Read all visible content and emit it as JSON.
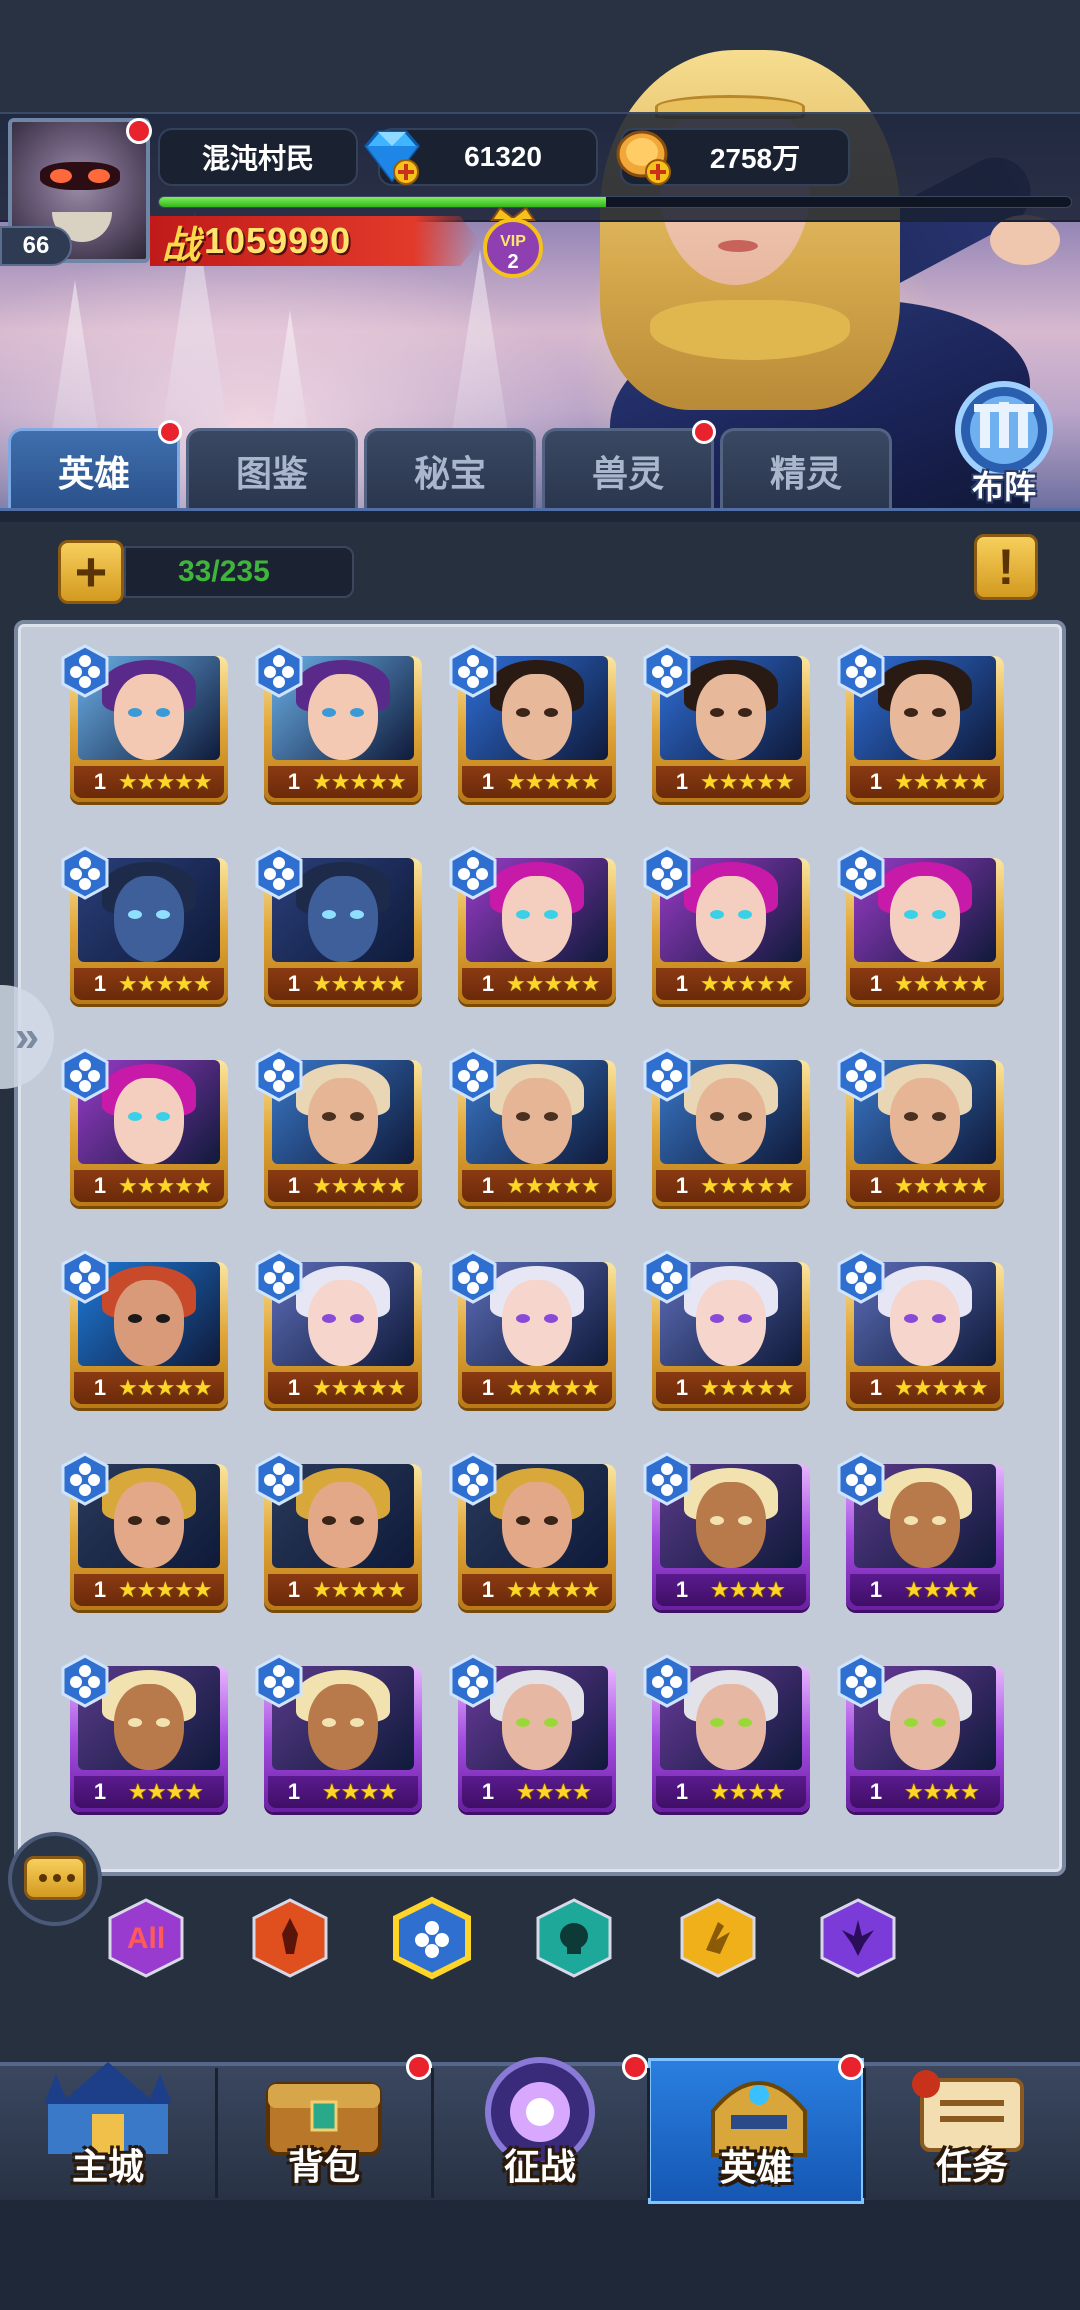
{
  "player": {
    "name": "混沌村民",
    "level": "66",
    "gems": "61320",
    "gold": "2758万",
    "power_char": "战",
    "power": "1059990",
    "vip_label": "VIP",
    "vip_level": "2",
    "exp_fraction": 0.49
  },
  "formation": {
    "label": "布阵"
  },
  "tabs": [
    {
      "label": "英雄",
      "active": true,
      "badge": true
    },
    {
      "label": "图鉴",
      "active": false,
      "badge": false
    },
    {
      "label": "秘宝",
      "active": false,
      "badge": false
    },
    {
      "label": "兽灵",
      "active": false,
      "badge": true
    },
    {
      "label": "精灵",
      "active": false,
      "badge": false
    }
  ],
  "capacity": {
    "add_symbol": "+",
    "text": "33/235",
    "info_symbol": "!"
  },
  "heroes": [
    {
      "portrait": "goggles-girl-icon",
      "rarity": "gold",
      "level": "1",
      "stars": 5
    },
    {
      "portrait": "goggles-girl-icon",
      "rarity": "gold",
      "level": "1",
      "stars": 5
    },
    {
      "portrait": "dark-hair-man-icon",
      "rarity": "gold",
      "level": "1",
      "stars": 5
    },
    {
      "portrait": "dark-hair-man-icon",
      "rarity": "gold",
      "level": "1",
      "stars": 5
    },
    {
      "portrait": "dark-hair-man-icon",
      "rarity": "gold",
      "level": "1",
      "stars": 5
    },
    {
      "portrait": "armored-knight-icon",
      "rarity": "gold",
      "level": "1",
      "stars": 5
    },
    {
      "portrait": "armored-knight-icon",
      "rarity": "gold",
      "level": "1",
      "stars": 5
    },
    {
      "portrait": "magenta-hair-woman-icon",
      "rarity": "gold",
      "level": "1",
      "stars": 5
    },
    {
      "portrait": "magenta-hair-woman-icon",
      "rarity": "gold",
      "level": "1",
      "stars": 5
    },
    {
      "portrait": "magenta-hair-woman-icon",
      "rarity": "gold",
      "level": "1",
      "stars": 5
    },
    {
      "portrait": "magenta-hair-woman-icon",
      "rarity": "gold",
      "level": "1",
      "stars": 5
    },
    {
      "portrait": "bearded-elder-icon",
      "rarity": "gold",
      "level": "1",
      "stars": 5
    },
    {
      "portrait": "bearded-elder-icon",
      "rarity": "gold",
      "level": "1",
      "stars": 5
    },
    {
      "portrait": "bearded-elder-icon",
      "rarity": "gold",
      "level": "1",
      "stars": 5
    },
    {
      "portrait": "bearded-elder-icon",
      "rarity": "gold",
      "level": "1",
      "stars": 5
    },
    {
      "portrait": "eyepatch-warrior-icon",
      "rarity": "gold",
      "level": "1",
      "stars": 5
    },
    {
      "portrait": "white-hair-sorceress-icon",
      "rarity": "gold",
      "level": "1",
      "stars": 5
    },
    {
      "portrait": "white-hair-sorceress-icon",
      "rarity": "gold",
      "level": "1",
      "stars": 5
    },
    {
      "portrait": "white-hair-sorceress-icon",
      "rarity": "gold",
      "level": "1",
      "stars": 5
    },
    {
      "portrait": "white-hair-sorceress-icon",
      "rarity": "gold",
      "level": "1",
      "stars": 5
    },
    {
      "portrait": "golden-helm-warrior-icon",
      "rarity": "gold",
      "level": "1",
      "stars": 5
    },
    {
      "portrait": "golden-helm-warrior-icon",
      "rarity": "gold",
      "level": "1",
      "stars": 5
    },
    {
      "portrait": "golden-helm-warrior-icon",
      "rarity": "gold",
      "level": "1",
      "stars": 5
    },
    {
      "portrait": "masked-blonde-warrior-icon",
      "rarity": "purple",
      "level": "1",
      "stars": 4
    },
    {
      "portrait": "masked-blonde-warrior-icon",
      "rarity": "purple",
      "level": "1",
      "stars": 4
    },
    {
      "portrait": "masked-blonde-warrior-icon",
      "rarity": "purple",
      "level": "1",
      "stars": 4
    },
    {
      "portrait": "masked-blonde-warrior-icon",
      "rarity": "purple",
      "level": "1",
      "stars": 4
    },
    {
      "portrait": "white-beard-goggle-sage-icon",
      "rarity": "purple",
      "level": "1",
      "stars": 4
    },
    {
      "portrait": "white-beard-goggle-sage-icon",
      "rarity": "purple",
      "level": "1",
      "stars": 4
    },
    {
      "portrait": "white-beard-goggle-sage-icon",
      "rarity": "purple",
      "level": "1",
      "stars": 4
    }
  ],
  "filters": [
    {
      "label": "All",
      "icon": "all-factions-icon",
      "selected": false
    },
    {
      "label": "",
      "icon": "fire-faction-icon",
      "selected": false
    },
    {
      "label": "",
      "icon": "water-faction-icon",
      "selected": true
    },
    {
      "label": "",
      "icon": "skull-faction-icon",
      "selected": false
    },
    {
      "label": "",
      "icon": "light-faction-icon",
      "selected": false
    },
    {
      "label": "",
      "icon": "dark-faction-icon",
      "selected": false
    }
  ],
  "nav": [
    {
      "label": "主城",
      "icon": "castle-icon",
      "active": false,
      "badge": false
    },
    {
      "label": "背包",
      "icon": "treasure-chest-icon",
      "active": false,
      "badge": true
    },
    {
      "label": "征战",
      "icon": "dragon-portal-icon",
      "active": false,
      "badge": true
    },
    {
      "label": "英雄",
      "icon": "hero-helmet-icon",
      "active": true,
      "badge": true
    },
    {
      "label": "任务",
      "icon": "scroll-icon",
      "active": false,
      "badge": false
    }
  ],
  "colors": {
    "badge_red": "#e8232d",
    "gold_frame": "#e0a537",
    "purple_frame": "#a44de0",
    "active_blue": "#2a7fe0",
    "capacity_green": "#3fb53b"
  }
}
